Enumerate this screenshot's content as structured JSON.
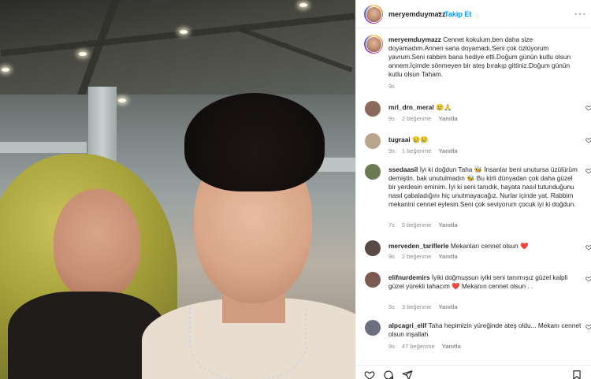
{
  "post": {
    "author": "meryemduymazz",
    "follow_separator": "•",
    "follow_label": "Takip Et",
    "caption": "Cennet kokulum,ben daha size doyamadım.Annen sana doyamadı.Seni çok özlüyorum yavrum.Seni rabbim bana hediye etti.Doğum günün kutlu olsun annem.İçimde sönmeyen bir ateş bırakıp gittiniz.Doğum günün kutlu olsun Taham.",
    "caption_time": "9s"
  },
  "comments": [
    {
      "user": "mrl_drn_meral",
      "text": "😢🙏",
      "time": "9s",
      "likes": "2 beğenme",
      "reply": "Yanıtla",
      "avatar_color": "#8a6a5a"
    },
    {
      "user": "tugraai",
      "text": "😢😢",
      "time": "9s",
      "likes": "1 beğenme",
      "reply": "Yanıtla",
      "avatar_color": "#b9a58e"
    },
    {
      "user": "ssedaasil",
      "text": "İyi ki doğdun Taha 🐝 İnsanlar beni unutursa üzülürüm demiştin, bak unutulmadın 🐝 Bu kirli dünyadan çok daha güzel bir yerdesin eminim. İyi ki seni tanıdık, hayata nasıl tutunduğunu nasıl çabaladığını hiç unutmayacağız. Nurlar içinde yat. Rabbim mekanini cennet eylesin.Seni çok seviyorum çocuk iyi ki doğdun.",
      "time": "7s",
      "likes": "5 beğenme",
      "reply": "Yanıtla",
      "avatar_color": "#6b7a52"
    },
    {
      "user": "merveden_tariflerle",
      "text": "Mekanları cennet olsun ❤️",
      "time": "9s",
      "likes": "2 beğenme",
      "reply": "Yanıtla",
      "avatar_color": "#5a4a44"
    },
    {
      "user": "elifnurdemirs",
      "text": "İyiki doğmuşsun iyiki seni tanımışız güzel kalpli güzel yürekli tahacım ❤️ Mekanın cennet olsun . .",
      "time": "5s",
      "likes": "3 beğenme",
      "reply": "Yanıtla",
      "avatar_color": "#7a5a50"
    },
    {
      "user": "alpcagri_elif",
      "text": "Taha hepimizin yüreğinde ateş oldu... Mekanı cennet olsun inşallah",
      "time": "9s",
      "likes": "47 beğenme",
      "reply": "Yanıtla",
      "avatar_color": "#6a7080"
    }
  ]
}
